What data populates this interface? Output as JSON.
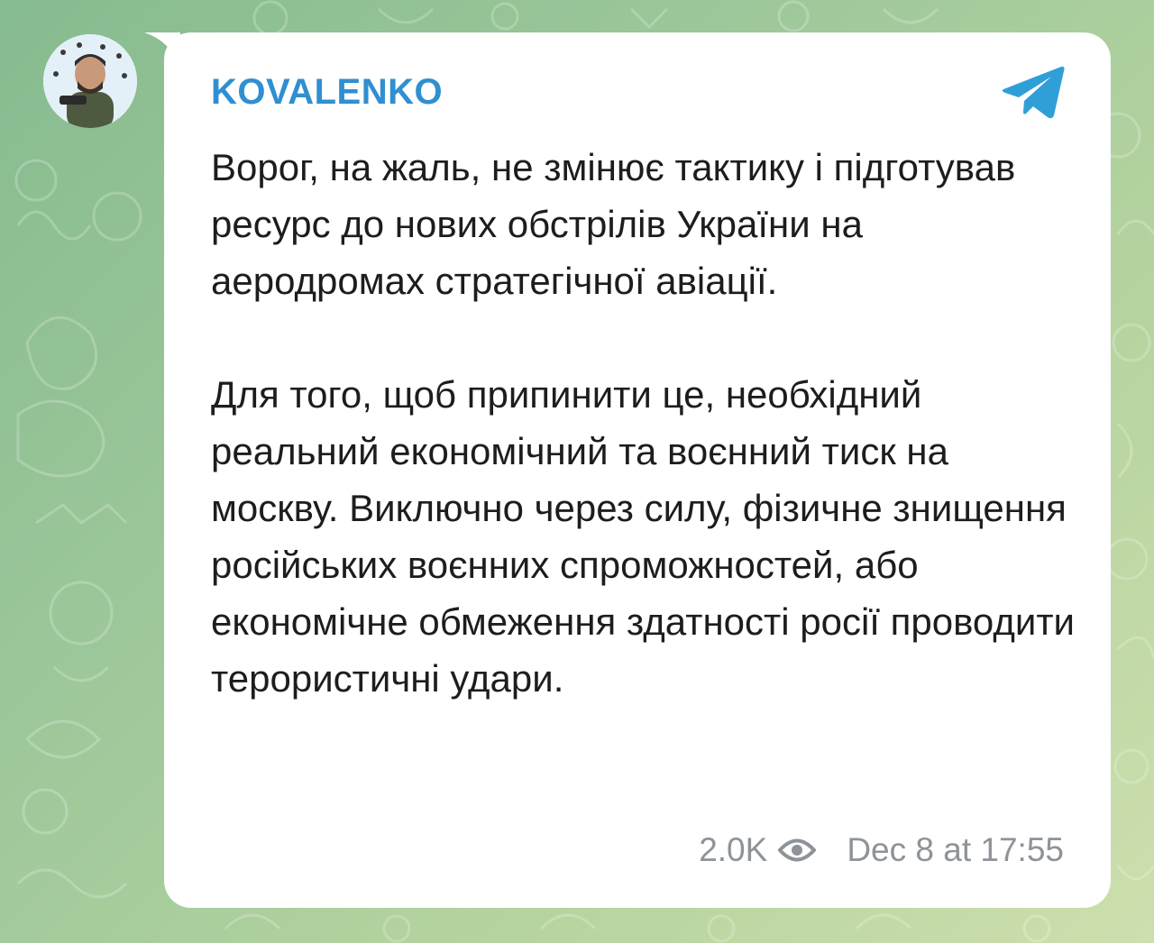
{
  "post": {
    "sender": "KOVALENKO",
    "paragraphs": [
      "Ворог, на жаль, не змінює тактику і підготував ресурс до нових обстрілів України на аеродромах стратегічної авіації.",
      "Для того, щоб припинити це, необхідний реальний економічний та воєнний тиск на москву. Виключно через силу, фізичне знищення російських воєнних спроможностей, або економічне обмеження здатності росії проводити терористичні удари."
    ],
    "views": "2.0K",
    "timestamp": "Dec 8 at 17:55"
  },
  "icons": {
    "channel_logo": "telegram-logo-icon",
    "views": "eye-icon"
  },
  "colors": {
    "sender_name": "#2f8fd1",
    "telegram_logo": "#2f9fd8",
    "meta_text": "#8d9398",
    "bubble": "#ffffff"
  }
}
